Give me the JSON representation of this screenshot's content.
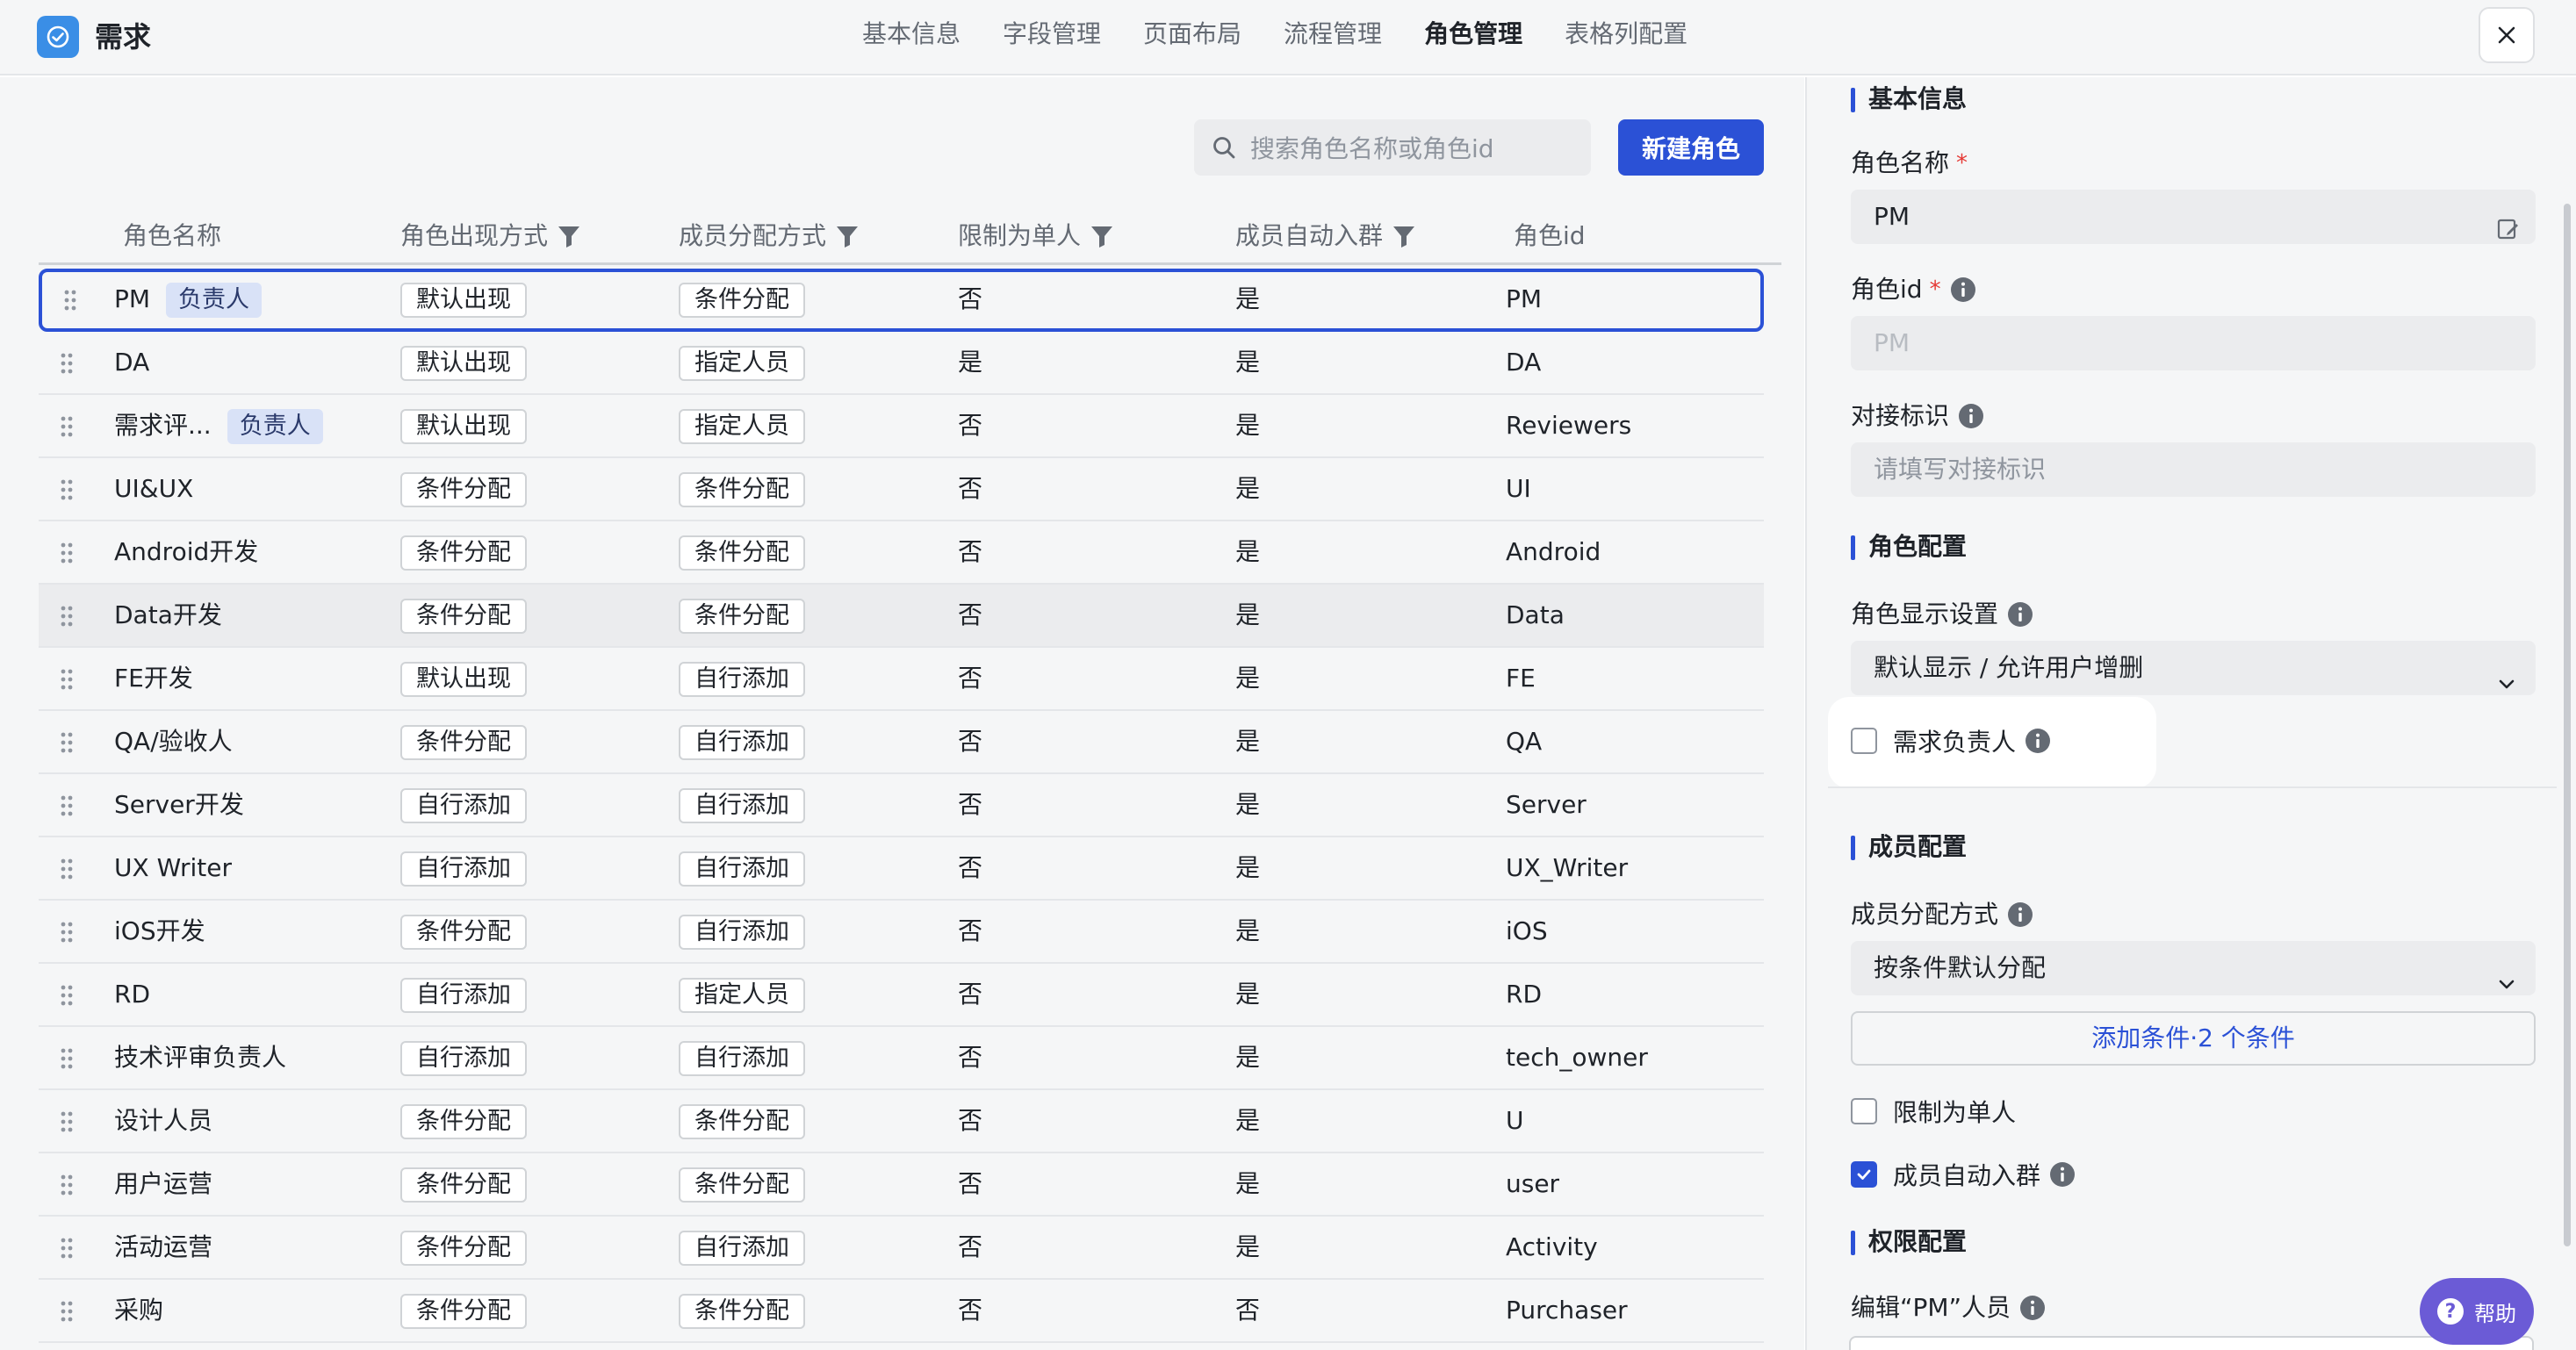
{
  "header": {
    "title": "需求",
    "tabs": [
      "基本信息",
      "字段管理",
      "页面布局",
      "流程管理",
      "角色管理",
      "表格列配置"
    ],
    "active_tab": "角色管理"
  },
  "toolbar": {
    "search_placeholder": "搜索角色名称或角色id",
    "new_role_label": "新建角色"
  },
  "table": {
    "columns": [
      "角色名称",
      "角色出现方式",
      "成员分配方式",
      "限制为单人",
      "成员自动入群",
      "角色id"
    ],
    "owner_badge": "负责人",
    "rows": [
      {
        "name": "PM",
        "owner": true,
        "appear": "默认出现",
        "assign": "条件分配",
        "single": "否",
        "autojoin": "是",
        "id": "PM"
      },
      {
        "name": "DA",
        "owner": false,
        "appear": "默认出现",
        "assign": "指定人员",
        "single": "是",
        "autojoin": "是",
        "id": "DA"
      },
      {
        "name": "需求评...",
        "owner": true,
        "appear": "默认出现",
        "assign": "指定人员",
        "single": "否",
        "autojoin": "是",
        "id": "Reviewers"
      },
      {
        "name": "UI&UX",
        "owner": false,
        "appear": "条件分配",
        "assign": "条件分配",
        "single": "否",
        "autojoin": "是",
        "id": "UI"
      },
      {
        "name": "Android开发",
        "owner": false,
        "appear": "条件分配",
        "assign": "条件分配",
        "single": "否",
        "autojoin": "是",
        "id": "Android"
      },
      {
        "name": "Data开发",
        "owner": false,
        "appear": "条件分配",
        "assign": "条件分配",
        "single": "否",
        "autojoin": "是",
        "id": "Data"
      },
      {
        "name": "FE开发",
        "owner": false,
        "appear": "默认出现",
        "assign": "自行添加",
        "single": "否",
        "autojoin": "是",
        "id": "FE"
      },
      {
        "name": "QA/验收人",
        "owner": false,
        "appear": "条件分配",
        "assign": "自行添加",
        "single": "否",
        "autojoin": "是",
        "id": "QA"
      },
      {
        "name": "Server开发",
        "owner": false,
        "appear": "自行添加",
        "assign": "自行添加",
        "single": "否",
        "autojoin": "是",
        "id": "Server"
      },
      {
        "name": "UX Writer",
        "owner": false,
        "appear": "自行添加",
        "assign": "自行添加",
        "single": "否",
        "autojoin": "是",
        "id": "UX_Writer"
      },
      {
        "name": "iOS开发",
        "owner": false,
        "appear": "条件分配",
        "assign": "自行添加",
        "single": "否",
        "autojoin": "是",
        "id": "iOS"
      },
      {
        "name": "RD",
        "owner": false,
        "appear": "自行添加",
        "assign": "指定人员",
        "single": "否",
        "autojoin": "是",
        "id": "RD"
      },
      {
        "name": "技术评审负责人",
        "owner": false,
        "appear": "自行添加",
        "assign": "自行添加",
        "single": "否",
        "autojoin": "是",
        "id": "tech_owner"
      },
      {
        "name": "设计人员",
        "owner": false,
        "appear": "条件分配",
        "assign": "条件分配",
        "single": "否",
        "autojoin": "是",
        "id": "U"
      },
      {
        "name": "用户运营",
        "owner": false,
        "appear": "条件分配",
        "assign": "条件分配",
        "single": "否",
        "autojoin": "是",
        "id": "user"
      },
      {
        "name": "活动运营",
        "owner": false,
        "appear": "条件分配",
        "assign": "自行添加",
        "single": "否",
        "autojoin": "是",
        "id": "Activity"
      },
      {
        "name": "采购",
        "owner": false,
        "appear": "条件分配",
        "assign": "条件分配",
        "single": "否",
        "autojoin": "否",
        "id": "Purchaser"
      }
    ]
  },
  "panel": {
    "basic_title": "基本信息",
    "role_name_label": "角色名称",
    "role_name_value": "PM",
    "role_id_label": "角色id",
    "role_id_value": "PM",
    "docking_label": "对接标识",
    "docking_placeholder": "请填写对接标识",
    "role_config_title": "角色配置",
    "display_label": "角色显示设置",
    "display_value": "默认显示 / 允许用户增删",
    "owner_checkbox_label": "需求负责人",
    "owner_checked": false,
    "member_config_title": "成员配置",
    "assign_label": "成员分配方式",
    "assign_value": "按条件默认分配",
    "add_condition_label": "添加条件·2 个条件",
    "single_label": "限制为单人",
    "single_checked": false,
    "autojoin_label": "成员自动入群",
    "autojoin_checked": true,
    "perm_title": "权限配置",
    "edit_members_label": "编辑“PM”人员",
    "required_mark": "*"
  },
  "help": {
    "label": "帮助",
    "icon_text": "?"
  },
  "colors": {
    "accent": "#2b51d6",
    "logo": "#3a8ee6",
    "help": "#6b5bd6"
  }
}
